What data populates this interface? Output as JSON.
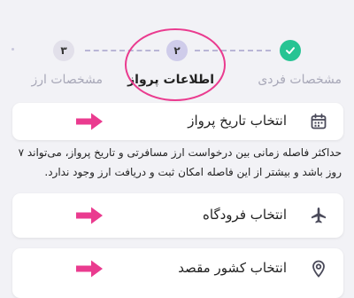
{
  "stepper": {
    "steps": [
      {
        "number": "",
        "label": "مشخصات فردی",
        "state": "done"
      },
      {
        "number": "۲",
        "label": "اطلاعات پرواز",
        "state": "active"
      },
      {
        "number": "۳",
        "label": "مشخصات ارز",
        "state": "pending"
      }
    ]
  },
  "date_card": {
    "title": "انتخاب تاریخ پرواز",
    "icon": "calendar-icon",
    "note": "حداکثر فاصله زمانی بین درخواست ارز مسافرتی و تاریخ پرواز، می‌تواند ۷ روز باشد و بیشتر از این فاصله امکان ثبت و دریافت ارز وجود ندارد."
  },
  "airport_card": {
    "title": "انتخاب فرودگاه",
    "icon": "airplane-icon"
  },
  "country_card": {
    "title": "انتخاب کشور مقصد",
    "icon": "location-pin-icon"
  },
  "colors": {
    "accent_pink": "#ea3b8f",
    "done_green": "#27c493",
    "active_step": "#cfccea",
    "dashed_line": "#b9b6d6"
  }
}
